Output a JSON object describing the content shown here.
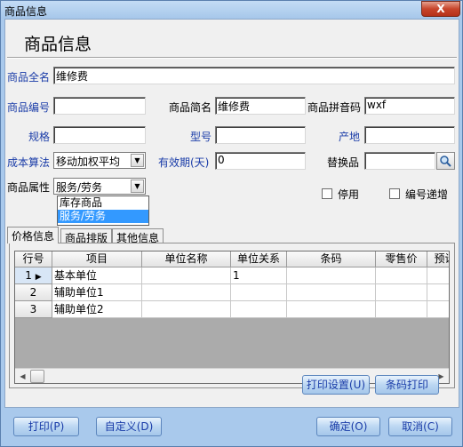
{
  "window": {
    "title": "商品信息",
    "close_label": "X"
  },
  "header": {
    "heading": "商品信息"
  },
  "form": {
    "full_name": {
      "label": "商品全名",
      "value": "维修费"
    },
    "code": {
      "label": "商品编号",
      "value": ""
    },
    "short_name": {
      "label": "商品简名",
      "value": "维修费"
    },
    "pinyin": {
      "label": "商品拼音码",
      "value": "wxf"
    },
    "spec": {
      "label": "规格",
      "value": ""
    },
    "model": {
      "label": "型号",
      "value": ""
    },
    "origin": {
      "label": "产地",
      "value": ""
    },
    "cost_method": {
      "label": "成本算法",
      "value": "移动加权平均"
    },
    "validity": {
      "label": "有效期(天)",
      "value": "0"
    },
    "substitute": {
      "label": "替换品",
      "value": ""
    },
    "attribute": {
      "label": "商品属性",
      "value": "服务/劳务",
      "options": [
        "库存商品",
        "服务/劳务"
      ]
    },
    "disabled": {
      "label": "停用"
    },
    "code_increment": {
      "label": "编号递增"
    }
  },
  "tabs": [
    {
      "label": "价格信息"
    },
    {
      "label": "商品排版"
    },
    {
      "label": "其他信息"
    }
  ],
  "grid": {
    "columns": [
      "行号",
      "项目",
      "单位名称",
      "单位关系",
      "条码",
      "零售价",
      "预设"
    ],
    "rows": [
      {
        "num": "1",
        "item": "基本单位",
        "unit_name": "",
        "relation": "1",
        "barcode": "",
        "price": "",
        "preset": ""
      },
      {
        "num": "2",
        "item": "辅助单位1",
        "unit_name": "",
        "relation": "",
        "barcode": "",
        "price": "",
        "preset": ""
      },
      {
        "num": "3",
        "item": "辅助单位2",
        "unit_name": "",
        "relation": "",
        "barcode": "",
        "price": "",
        "preset": ""
      }
    ]
  },
  "panel_buttons": {
    "print_settings": "打印设置(U)",
    "barcode_print": "条码打印"
  },
  "footer": {
    "print": "打印(P)",
    "customize": "自定义(D)",
    "ok": "确定(O)",
    "cancel": "取消(C)"
  },
  "colors": {
    "accent_text": "#1a3ca8",
    "frame": "#a9c9ec",
    "selection": "#3399ff"
  }
}
